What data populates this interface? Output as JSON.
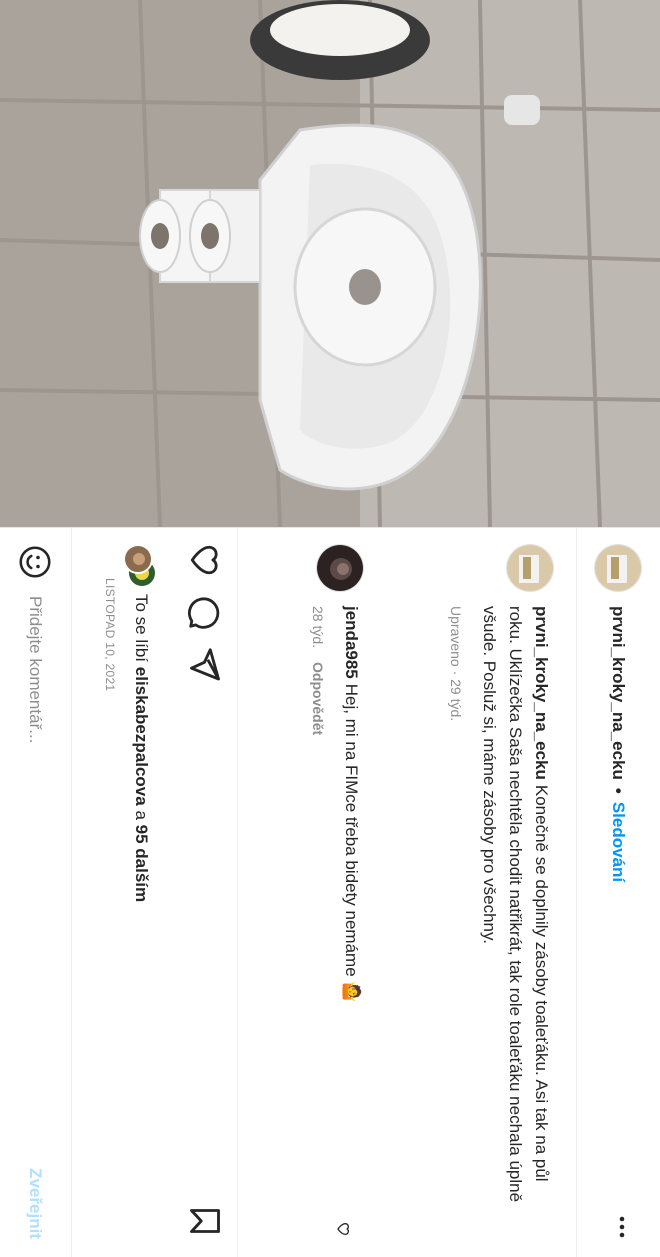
{
  "post": {
    "author": "prvni_kroky_na_ecku",
    "separator": "•",
    "follow_label": "Sledování",
    "more_label": "⋮",
    "caption": "Konečně se doplnily zásoby toaleťáku. Asi tak na půl roku. Uklízečka Saša nechtěla chodit natřikrát, tak role toaleťáku nechala úplně všude. Posluž si, máme zásoby pro všechny.",
    "caption_meta": "Upraveno · 29 týd.",
    "photo_icon": "toilet-paper-bidet-photo"
  },
  "comments": [
    {
      "username": "jenda985",
      "text": "Hej, mi na FIMce třeba bidety nemáme 🤷",
      "age": "28 týd.",
      "reply_label": "Odpovědět"
    }
  ],
  "likes": {
    "prefix": "To se líbí",
    "user": "eliskabezpalcova",
    "joiner": "a",
    "others": "95 dalším"
  },
  "date": "LISTOPAD 10, 2021",
  "add_comment": {
    "placeholder": "Přidejte komentář...",
    "post_label": "Zveřejnit"
  },
  "colors": {
    "accent": "#0095f6",
    "post_disabled": "#b2dffc",
    "text": "#262626",
    "muted": "#8e8e8e"
  },
  "icons": {
    "like": "heart-icon",
    "comment": "comment-icon",
    "share": "send-icon",
    "save": "bookmark-icon",
    "emoji": "smiley-icon",
    "more": "more-dots-icon"
  }
}
